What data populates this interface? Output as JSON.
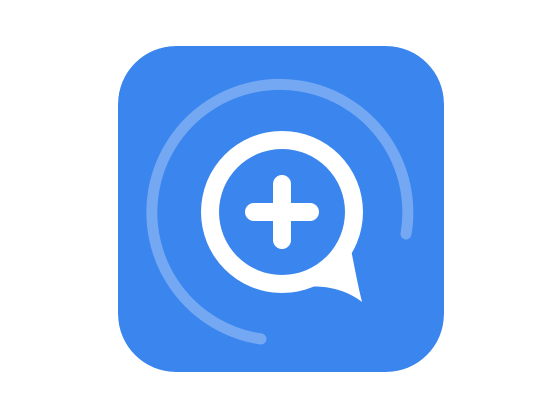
{
  "icon": {
    "name": "medical-chat-app-icon",
    "glyph": "plus-in-speech-bubble",
    "colors": {
      "tile": "#3A85EE",
      "ring": "#74A8F3",
      "bubble": "#FFFFFF",
      "cross": "#FFFFFF"
    }
  }
}
